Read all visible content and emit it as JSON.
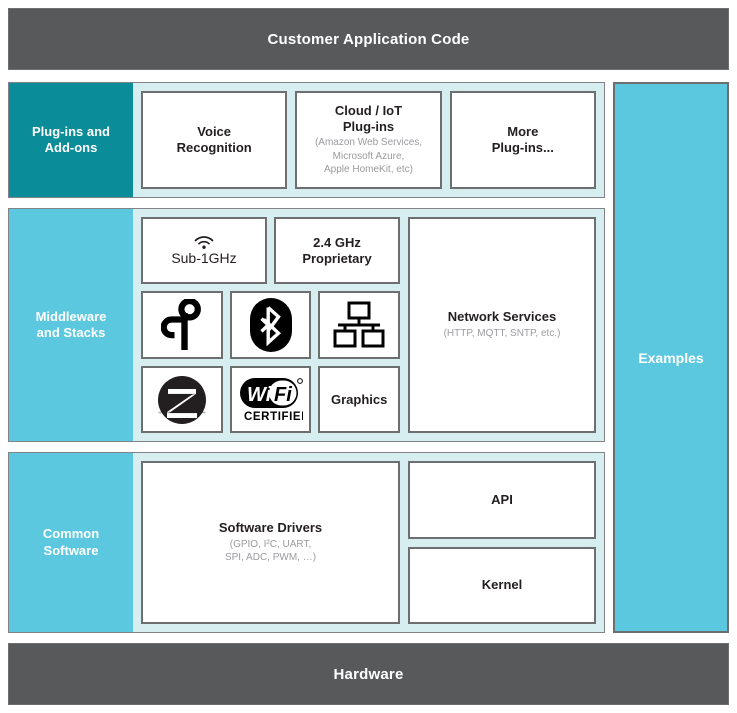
{
  "header": {
    "title": "Customer Application Code"
  },
  "footer": {
    "title": "Hardware"
  },
  "sidebar_right": {
    "label": "Examples"
  },
  "rows": [
    {
      "label": "Plug-ins and\nAdd-ons",
      "label_color": "#0b8c99",
      "cards": [
        {
          "title": "Voice\nRecognition",
          "sub": ""
        },
        {
          "title": "Cloud / IoT\nPlug-ins",
          "sub": "(Amazon Web Services,\nMicrosoft Azure,\nApple HomeKit, etc)"
        },
        {
          "title": "More\nPlug-ins...",
          "sub": ""
        }
      ]
    },
    {
      "label": "Middleware\nand Stacks",
      "label_color": "#5cc8e0",
      "cards": [
        {
          "title": "Sub-1GHz",
          "sub": "",
          "icon": "wireless-signal-icon"
        },
        {
          "title": "2.4 GHz\nProprietary",
          "sub": ""
        },
        {
          "title": "",
          "sub": "",
          "icon": "thread-logo-icon"
        },
        {
          "title": "",
          "sub": "",
          "icon": "bluetooth-logo-icon"
        },
        {
          "title": "",
          "sub": "",
          "icon": "wired-network-icon"
        },
        {
          "title": "",
          "sub": "",
          "icon": "zigbee-logo-icon"
        },
        {
          "title": "",
          "sub": "",
          "icon": "wifi-certified-logo-icon"
        },
        {
          "title": "Graphics",
          "sub": ""
        },
        {
          "title": "Network Services",
          "sub": "(HTTP, MQTT, SNTP, etc.)"
        }
      ]
    },
    {
      "label": "Common\nSoftware",
      "label_color": "#5cc8e0",
      "cards": [
        {
          "title": "Software Drivers",
          "sub": "(GPIO, I²C, UART,\nSPI, ADC, PWM, …)"
        },
        {
          "title": "API",
          "sub": ""
        },
        {
          "title": "Kernel",
          "sub": ""
        }
      ]
    }
  ],
  "colors": {
    "bar_grey": "#58595b",
    "teal_dark": "#0b8c99",
    "cyan": "#5cc8e0",
    "panel_bg": "#d6eef0",
    "card_border": "#6d6e70",
    "sub_text": "#9a9b9e"
  }
}
